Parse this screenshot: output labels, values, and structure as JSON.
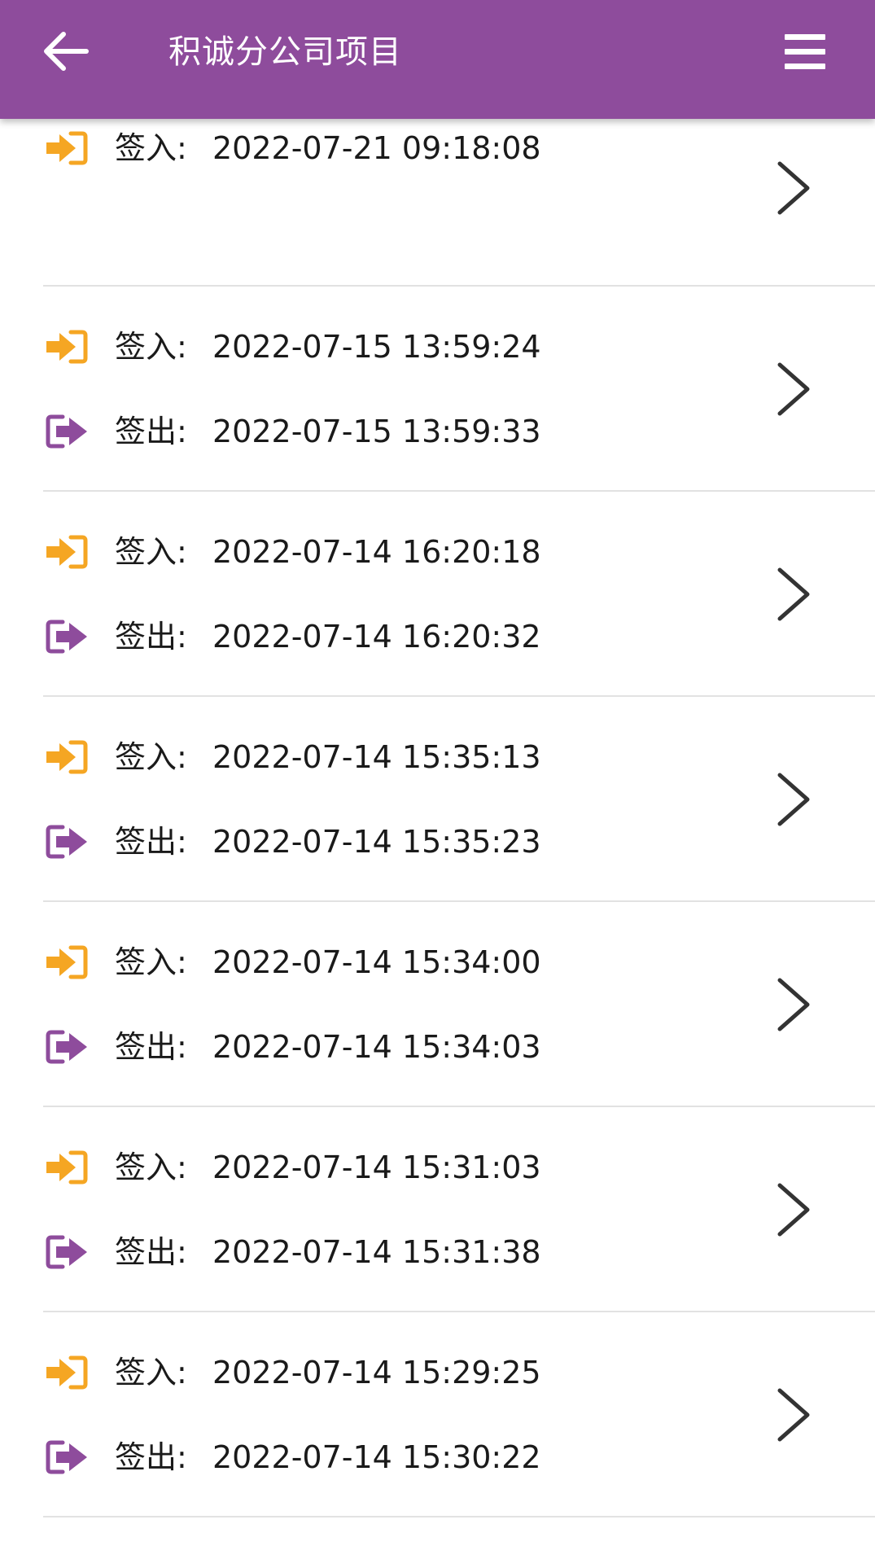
{
  "header": {
    "title": "积诚分公司项目",
    "back_icon": "arrow-left-icon",
    "menu_icon": "hamburger-menu-icon"
  },
  "colors": {
    "header_bg": "#8e4c9c",
    "sign_in_icon": "#f5a623",
    "sign_out_icon": "#8e4c9c",
    "divider": "#e2e2e2"
  },
  "labels": {
    "sign_in": "签入:",
    "sign_out": "签出:"
  },
  "records": [
    {
      "sign_in": "2022-07-21 09:18:08",
      "sign_out": null
    },
    {
      "sign_in": "2022-07-15 13:59:24",
      "sign_out": "2022-07-15 13:59:33"
    },
    {
      "sign_in": "2022-07-14 16:20:18",
      "sign_out": "2022-07-14 16:20:32"
    },
    {
      "sign_in": "2022-07-14 15:35:13",
      "sign_out": "2022-07-14 15:35:23"
    },
    {
      "sign_in": "2022-07-14 15:34:00",
      "sign_out": "2022-07-14 15:34:03"
    },
    {
      "sign_in": "2022-07-14 15:31:03",
      "sign_out": "2022-07-14 15:31:38"
    },
    {
      "sign_in": "2022-07-14 15:29:25",
      "sign_out": "2022-07-14 15:30:22"
    }
  ]
}
